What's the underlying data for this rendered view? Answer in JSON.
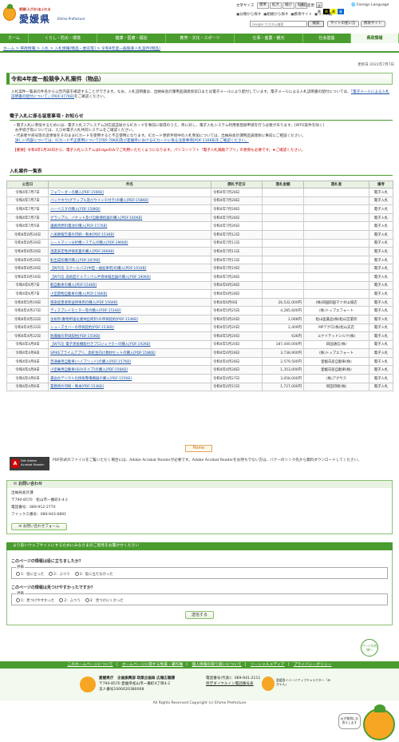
{
  "header": {
    "logo_tagline": "愛顔(えがお)あふれる",
    "logo_name": "愛媛県",
    "logo_en": "Ehime Prefecture",
    "font_size_label": "文字サイズ",
    "font_sizes": [
      "標準",
      "拡大",
      "縮小",
      "拡大"
    ],
    "color_label": "色の変更",
    "colors": [
      "標準",
      "黒",
      "黄",
      "青"
    ],
    "foreign_language": "Foreign Language",
    "utility_links": [
      "分類から探す",
      "組織から探す",
      "携帯サイト",
      "リンク集"
    ],
    "search_placeholder": "Google カスタム検索",
    "search_button": "検索",
    "how_to_use": "使い方",
    "sitemap": "サイトの使い方",
    "mobile": "携帯サイト"
  },
  "nav": {
    "items": [
      "ホーム",
      "くらし・防災・環境",
      "健康・医療・福祉",
      "教育・文化・スポーツ",
      "仕事・産業・観光",
      "社会基盤",
      "県政情報"
    ],
    "active_index": 6
  },
  "breadcrumb": "ホーム > 県政情報 > 入札 > 入札情報(物品・委託等) > 令和4年度一般競争入札案件(物品)",
  "page": {
    "updated": "更新日:2022年7月7日",
    "title": "令和4年度一般競争入札案件（物品）",
    "intro": "入札案件一覧表の件名から公告内容を確認することができます。なお、入札説明書は、出納局会計課用品調達係窓口または電子メールにより配付しています。電子メールによる入札説明書の配付については、",
    "intro_link": "「電子メールによる入札説明書の配付について」[PDF:477KB]",
    "intro_end": "をご確認ください。"
  },
  "ic_section": {
    "heading": "電子入札に係る留意事項・お知らせ",
    "bullet1": "電子入札に参加するためには、電子入札コアシステム対応認証局からICカードを事前に取得のうえ、県に対し、電子入札システム利用者登録申請を行う必要があります。[WTO案件を除く]",
    "bullet1b": "お手続き等については、えひめ電子入札共同システム",
    "bullet1c": "をご確認ください。",
    "bullet2": "代表者や商号等の変更後をそのままICカードを使用すると不正使用になります。ICカード更新手続中の入札参加については、出納局会計課用品調達係に事前にご相談ください。",
    "bullet2b": "詳しい内容については、ICカード不正使用について[PDF:78KB]及び愛媛県におけるICカードに係る注意事項[PDF:116KB]をご確認ください。",
    "notice": "【重要】令和4年1月30日から、電子入札システムはEdgeのみでご利用いただくようになります。パソコンソフト「電子入札補助アプリ」の更新も必要です。★ご確認ください。"
  },
  "list": {
    "heading": "入札案件一覧表",
    "headers": [
      "公告日",
      "件名",
      "開札予定日",
      "落札金額",
      "落札者",
      "備考"
    ],
    "rows": [
      [
        "令和4年7月7日",
        "フォワーダーの購入[PDF:156KB]",
        "令和4年7月28日",
        "",
        "",
        "電子入札"
      ],
      [
        "令和4年7月7日",
        "バックホウ(グラップル及びウインチ付き)の購入[PDF:158KB]",
        "令和4年7月28日",
        "",
        "",
        "電子入札"
      ],
      [
        "令和4年7月7日",
        "ハーベスタの購入[PDF:158KB]",
        "令和4年7月28日",
        "",
        "",
        "電子入札"
      ],
      [
        "令和4年7月7日",
        "グラップル、バケット及び自動連結器の購入[PDF:160KB]",
        "令和4年7月28日",
        "",
        "",
        "電子入札"
      ],
      [
        "令和4年7月5日",
        "議員用燃料電池の購入[PDF:157KB]",
        "令和4年7月26日",
        "",
        "",
        "電子入札"
      ],
      [
        "令和4年6月24日",
        "八坂寮報告書の印刷・製本[PDF:153KB]",
        "令和4年7月12日",
        "",
        "",
        "電子入札"
      ],
      [
        "令和4年6月20日",
        "シートマシン分析機システムの購入[PDF:286KB]",
        "令和4年7月11日",
        "",
        "",
        "電子入札"
      ],
      [
        "令和4年6月20日",
        "湿度安定性評価装置の購入[PDF:266KB]",
        "令和4年7月11日",
        "",
        "",
        "電子入札"
      ],
      [
        "令和4年6月20日",
        "射出成形機の購入[PDF:287KB]",
        "令和4年7月11日",
        "",
        "",
        "電子入札"
      ],
      [
        "令和4年6月20日",
        "【WTO】スクールバス(中型・福祉車両)の購入[PDF:191KB]",
        "令和4年7月19日",
        "",
        "",
        "電子入札"
      ],
      [
        "令和4年6月16日",
        "【WTO】高純度ゲルマニウム半導体検出器の購入[PDF:190KB]",
        "令和4年7月28日",
        "",
        "",
        "電子入札"
      ],
      [
        "令和4年6月7日",
        "軽自動車の購入[PDF:154KB]",
        "令和4年6月28日",
        "",
        "",
        "電子入札"
      ],
      [
        "令和4年6月7日",
        "小型貨物自動車の購入[PDF:158KB]",
        "令和4年6月28日",
        "",
        "",
        "電子入札"
      ],
      [
        "令和4年5月19日",
        "感染症患者移送用車両の購入[PDF:156KB]",
        "令和4年6月9日",
        "26,532,000円",
        "(株)四国四国マツダ山城店",
        "電子入札"
      ],
      [
        "令和4年4月27日",
        "ディスプレイモニター等の購入[PDF:151KB]",
        "令和4年5月25日",
        "4,285,600円",
        "(株)トップエフォート",
        "電子入札"
      ],
      [
        "令和4年4月22日",
        "注射針(動物用強化素林出荷針)の単価契約[PDF:154KB]",
        "令和4年5月20日",
        "2,068円",
        "松山医薬品(株)松山営業所",
        "電子入札"
      ],
      [
        "令和4年4月22日",
        "シューズカバーの単価契約[PDF:153KB]",
        "令和4年5月20日",
        "2,409円",
        "MPアグロ(株)松山支店",
        "電子入札"
      ],
      [
        "令和4年4月22日",
        "防護服の単価契約[PDF:155KB]",
        "令和4年5月20日",
        "636円",
        "ユナイテッドシルク(株)",
        "電子入札"
      ],
      [
        "令和4年4月8日",
        "【WTO】電子黒板機能付きプロジェクターの購入[PDF:192KB]",
        "令和4年5月20日",
        "187,440,000円",
        "四国通信(株)",
        "電子入札"
      ],
      [
        "令和4年4月8日",
        "SPIKEプライムアプリ、高校生向け教材セットの購入[PDF:158KB]",
        "令和4年4月28日",
        "3,738,900円",
        "(株)トップエフォート",
        "電子入札"
      ],
      [
        "令和4年4月8日",
        "普通乗用自動車(ハイブリッド)の購入[PDF:157KB]",
        "令和4年4月28日",
        "2,579,500円",
        "愛媛日産自動車(株)",
        "電子入札"
      ],
      [
        "令和4年4月8日",
        "小型乗用自動車(SUVタイプ)の購入[PDF:156KB]",
        "令和4年4月28日",
        "1,353,000円",
        "愛媛日産自動車(株)",
        "電子入札"
      ],
      [
        "令和4年4月6日",
        "書画台デジタル化情報整備機器の購入[PDF:155KB]",
        "令和4年4月27日",
        "3,058,000円",
        "(株)アグサス",
        "電子入札"
      ],
      [
        "令和4年4月6日",
        "業務用の印刷・製本[PDF:153KB]",
        "令和4年4月15日",
        "1,727,000円",
        "岡田印刷(株)",
        "電子入札"
      ]
    ]
  },
  "home_button": "Home",
  "acrobat": {
    "badge_line1": "Get Adobe",
    "badge_line2": "Acrobat Reader",
    "note": "PDF形式のファイルをご覧いただく場合には、Adobe Acrobat Readerが必要です。Adobe Acrobat Readerをお持ちでない方は、バナーのリンク先から無料ダウンロードしてください。"
  },
  "inquiry": {
    "heading": "お問い合わせ",
    "dept": "出納局会計課",
    "address": "〒790-8570　松山市一番町4-4-2",
    "tel": "電話番号：089-912-2770",
    "fax": "ファックス番号：089-943-6891",
    "form_button": "お問い合わせフォーム"
  },
  "survey": {
    "heading": "より良いウェブサイトにするためにみなさまのご意見をお聞かせください",
    "q1": "このページの情報は役に立ちましたか？",
    "q1_legend": "評価",
    "q1_options": [
      "1：役に立った",
      "2：ふつう",
      "3：役に立たなかった"
    ],
    "q2": "このページの情報は見つけやすかったですか？",
    "q2_legend": "評価",
    "q2_options": [
      "1：見つけやすかった",
      "2：ふつう",
      "3：見つけにくかった"
    ],
    "send": "送信する"
  },
  "page_top": "ページの先頭へ",
  "footer": {
    "links": [
      "このホームページについて",
      "ホームページに関する免責・著作権",
      "個人情報の取り扱いについて",
      "ソーシャルメディア",
      "プライバシーポリシー"
    ],
    "org": "愛媛県庁　企画振興部 政策企画局 広報広聴課",
    "address": "〒790-8570 愛媛県松山市一番町4丁目4-2",
    "corp_no": "法人番号1000020380008",
    "tel": "電話番号(代表)：089-941-2111",
    "dial": "県庁ダイヤルイン電話番号表",
    "mascot": "愛媛県イメージアップキャラクター「みきゃん」",
    "copyright": "All Rights Reserved Copyright (c) Ehime Prefecture"
  },
  "help": {
    "text": "AIが質問にお答えします",
    "mascot_label": "みきゃん"
  }
}
